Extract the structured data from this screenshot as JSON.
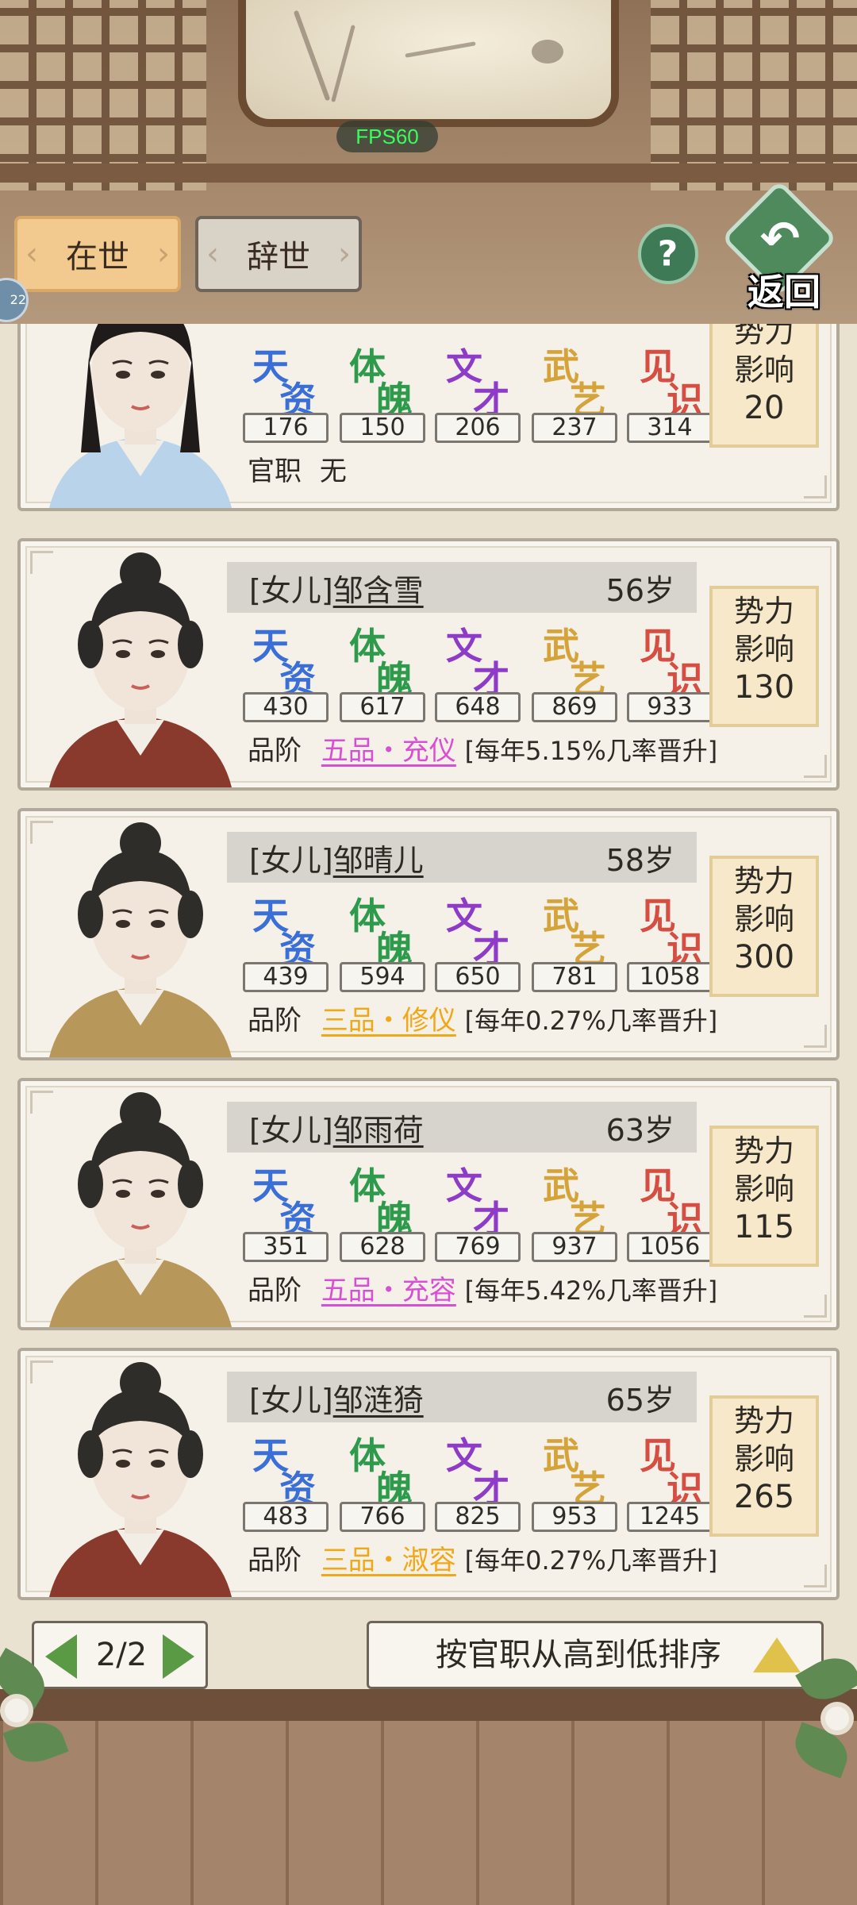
{
  "fps": "FPS60",
  "tabs": [
    {
      "label": "在世",
      "active": true
    },
    {
      "label": "辞世",
      "active": false
    }
  ],
  "help_label": "?",
  "back_label": "返回",
  "side_badge": "22",
  "stat_names": [
    {
      "c1": "天",
      "c2": "资",
      "color": "#3b6fd8"
    },
    {
      "c1": "体",
      "c2": "魄",
      "color": "#2e9a4c"
    },
    {
      "c1": "文",
      "c2": "才",
      "color": "#8e3bc8"
    },
    {
      "c1": "武",
      "c2": "艺",
      "color": "#d4a43a"
    },
    {
      "c1": "见",
      "c2": "识",
      "color": "#d64d42"
    }
  ],
  "influence_label_1": "势力",
  "influence_label_2": "影响",
  "rank_prefix": "品阶",
  "official_prefix": "官职",
  "cards": [
    {
      "partial": true,
      "title": "",
      "name": "",
      "age": "",
      "stats": [
        "176",
        "150",
        "206",
        "237",
        "314"
      ],
      "influence": "20",
      "official": "无",
      "portrait_colors": {
        "hair": "#1e1b1a",
        "robe": "#b9d3ea"
      }
    },
    {
      "title": "[女儿]",
      "name": "邹含雪",
      "age": "56岁",
      "stats": [
        "430",
        "617",
        "648",
        "869",
        "933"
      ],
      "influence": "130",
      "rank": "五品・充仪",
      "rank_color": "#d94fd3",
      "rate": "[每年5.15%几率晋升]",
      "portrait_colors": {
        "hair": "#2b2a28",
        "robe": "#8a3a2c"
      }
    },
    {
      "title": "[女儿]",
      "name": "邹晴儿",
      "age": "58岁",
      "stats": [
        "439",
        "594",
        "650",
        "781",
        "1058"
      ],
      "influence": "300",
      "rank": "三品・修仪",
      "rank_color": "#f0a818",
      "rate": "[每年0.27%几率晋升]",
      "portrait_colors": {
        "hair": "#2f2d2a",
        "robe": "#b8985a"
      }
    },
    {
      "title": "[女儿]",
      "name": "邹雨荷",
      "age": "63岁",
      "stats": [
        "351",
        "628",
        "769",
        "937",
        "1056"
      ],
      "influence": "115",
      "rank": "五品・充容",
      "rank_color": "#d94fd3",
      "rate": "[每年5.42%几率晋升]",
      "portrait_colors": {
        "hair": "#2f2d2a",
        "robe": "#b8985a"
      }
    },
    {
      "title": "[女儿]",
      "name": "邹涟猗",
      "age": "65岁",
      "stats": [
        "483",
        "766",
        "825",
        "953",
        "1245"
      ],
      "influence": "265",
      "rank": "三品・淑容",
      "rank_color": "#f0a818",
      "rate": "[每年0.27%几率晋升]",
      "portrait_colors": {
        "hair": "#2f2d2a",
        "robe": "#8a3a2c"
      }
    }
  ],
  "pager": {
    "label": "2/2"
  },
  "sort_label": "按官职从高到低排序"
}
